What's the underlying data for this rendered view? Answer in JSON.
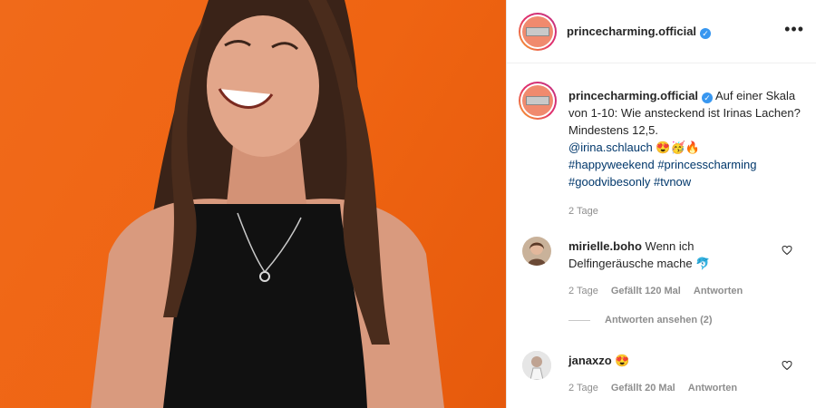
{
  "post": {
    "username": "princecharming.official",
    "caption_text": "Auf einer Skala von 1-10: Wie ansteckend ist Irinas Lachen? Mindestens 12,5.",
    "mention": "@irina.schlauch",
    "caption_emoji": "😍🥳🔥",
    "hashtags": [
      "#happyweekend",
      "#princesscharming",
      "#goodvibesonly",
      "#tvnow"
    ],
    "time": "2 Tage"
  },
  "comments": [
    {
      "username": "mirielle.boho",
      "text": "Wenn ich Delfingeräusche mache 🐬",
      "time": "2 Tage",
      "likes": "Gefällt 120 Mal",
      "reply_label": "Antworten",
      "view_replies": "Antworten ansehen (2)"
    },
    {
      "username": "janaxzo",
      "text": "😍",
      "time": "2 Tage",
      "likes": "Gefällt 20 Mal",
      "reply_label": "Antworten"
    }
  ],
  "colors": {
    "photo_background": "#ef6412",
    "link": "#00376b",
    "verified": "#3897f0",
    "meta_gray": "#8e8e8e"
  },
  "icons": [
    "verified-badge-icon",
    "more-options-icon",
    "heart-icon"
  ]
}
